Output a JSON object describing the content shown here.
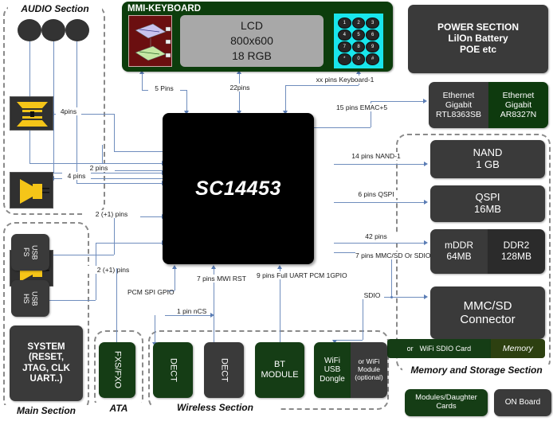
{
  "diagram": {
    "chip": {
      "name": "SC14453"
    },
    "sections": {
      "audio": "AUDIO Section",
      "main": "Main Section",
      "ata": "ATA",
      "wireless": "Wireless Section",
      "memory_storage": "Memory and Storage Section"
    },
    "mmi": {
      "title": "MMI-KEYBOARD",
      "lcd": {
        "line1": "LCD",
        "line2": "800x600",
        "line3": "18 RGB"
      },
      "keypad_keys": [
        "1",
        "2",
        "3",
        "4",
        "5",
        "6",
        "7",
        "8",
        "9",
        "*",
        "0",
        "#"
      ],
      "touchpad_name": "touchpad-graphic"
    },
    "blocks": {
      "power": {
        "line1": "POWER SECTION",
        "line2": "LilOn Battery",
        "line3": "POE etc"
      },
      "eth_left": {
        "line1": "Ethernet",
        "line2": "Gigabit",
        "line3": "RTL8363SB"
      },
      "eth_right": {
        "line1": "Ethernet",
        "line2": "Gigabit",
        "line3": "AR8327N"
      },
      "nand": {
        "line1": "NAND",
        "line2": "1 GB"
      },
      "qspi": {
        "line1": "QSPI",
        "line2": "16MB"
      },
      "mddr": {
        "line1": "mDDR",
        "line2": "64MB"
      },
      "ddr2": {
        "line1": "DDR2",
        "line2": "128MB"
      },
      "mmc_sd": {
        "line1": "MMC/SD",
        "line2": "Connector"
      },
      "wifi_sdio_card": {
        "prefix": "or",
        "label": "WiFi SDIO Card"
      },
      "memory_card": "Memory",
      "usb_fs": "USB\nFS",
      "usb_fs_l1": "USB",
      "usb_fs_l2": "FS",
      "usb_hs_l1": "USB",
      "usb_hs_l2": "HS",
      "system": {
        "line1": "SYSTEM",
        "line2": "(RESET,",
        "line3": "JTAG, CLK",
        "line4": "UART..)"
      },
      "fxs_fxo": "FXS/FXO",
      "dect1": "DECT",
      "dect2": "DECT",
      "bt": {
        "line1": "BT",
        "line2": "MODULE"
      },
      "wifi_usb": {
        "line1": "WiFi",
        "line2": "USB",
        "line3": "Dongle"
      },
      "wifi_module": {
        "line1": "or WiFi",
        "line2": "Module",
        "line3": "(optional)"
      }
    },
    "legend": {
      "modules_daughter": {
        "line1": "Modules/Daughter",
        "line2": "Cards"
      },
      "on_board": "ON Board"
    },
    "connections": [
      {
        "id": "lcd-5pins",
        "label": "5 Pins"
      },
      {
        "id": "lcd-22pins",
        "label": "22pins"
      },
      {
        "id": "keyboard-pins",
        "line1": "xx pins",
        "line2": "Keyboard-1"
      },
      {
        "id": "emac",
        "line1": "15 pins",
        "line2": "EMAC+5"
      },
      {
        "id": "nand-conn",
        "line1": "14 pins",
        "line2": "NAND-1"
      },
      {
        "id": "qspi-conn",
        "line1": "6 pins",
        "line2": "QSPI"
      },
      {
        "id": "ddr-conn",
        "line1": "42 pins"
      },
      {
        "id": "mmc-conn",
        "line1": "7 pins",
        "line2": "MMC/SD",
        "line3": "Or SDIO"
      },
      {
        "id": "sdio-conn",
        "label": "SDIO"
      },
      {
        "id": "audio-4pins-a",
        "label": "4pins"
      },
      {
        "id": "audio-2pins",
        "label": "2 pins"
      },
      {
        "id": "audio-4pins-b",
        "label": "4 pins"
      },
      {
        "id": "usb-fs-pins",
        "label": "2 (+1) pins"
      },
      {
        "id": "usb-hs-pins",
        "label": "2 (+1) pins"
      },
      {
        "id": "pcm-spi-gpio",
        "line1": "PCM",
        "line2": "SPI",
        "line3": "GPIO"
      },
      {
        "id": "ncs",
        "line1": "1 pin",
        "line2": "nCS"
      },
      {
        "id": "mwi-rst",
        "line1": "7 pins",
        "line2": "MWI",
        "line3": "RST"
      },
      {
        "id": "full-uart",
        "line1": "9 pins",
        "line2": "Full UART",
        "line3": "PCM",
        "line4": "1GPIO"
      }
    ],
    "colors": {
      "line": "#6f8dbd",
      "dark_block": "#3a3a3a",
      "green_block": "#153d15",
      "chip": "#000000",
      "keypad": "#19e6ec",
      "touchpad": "#6b0f10",
      "lcd": "#a8a8a8",
      "accent_yellow": "#f5c518"
    }
  }
}
